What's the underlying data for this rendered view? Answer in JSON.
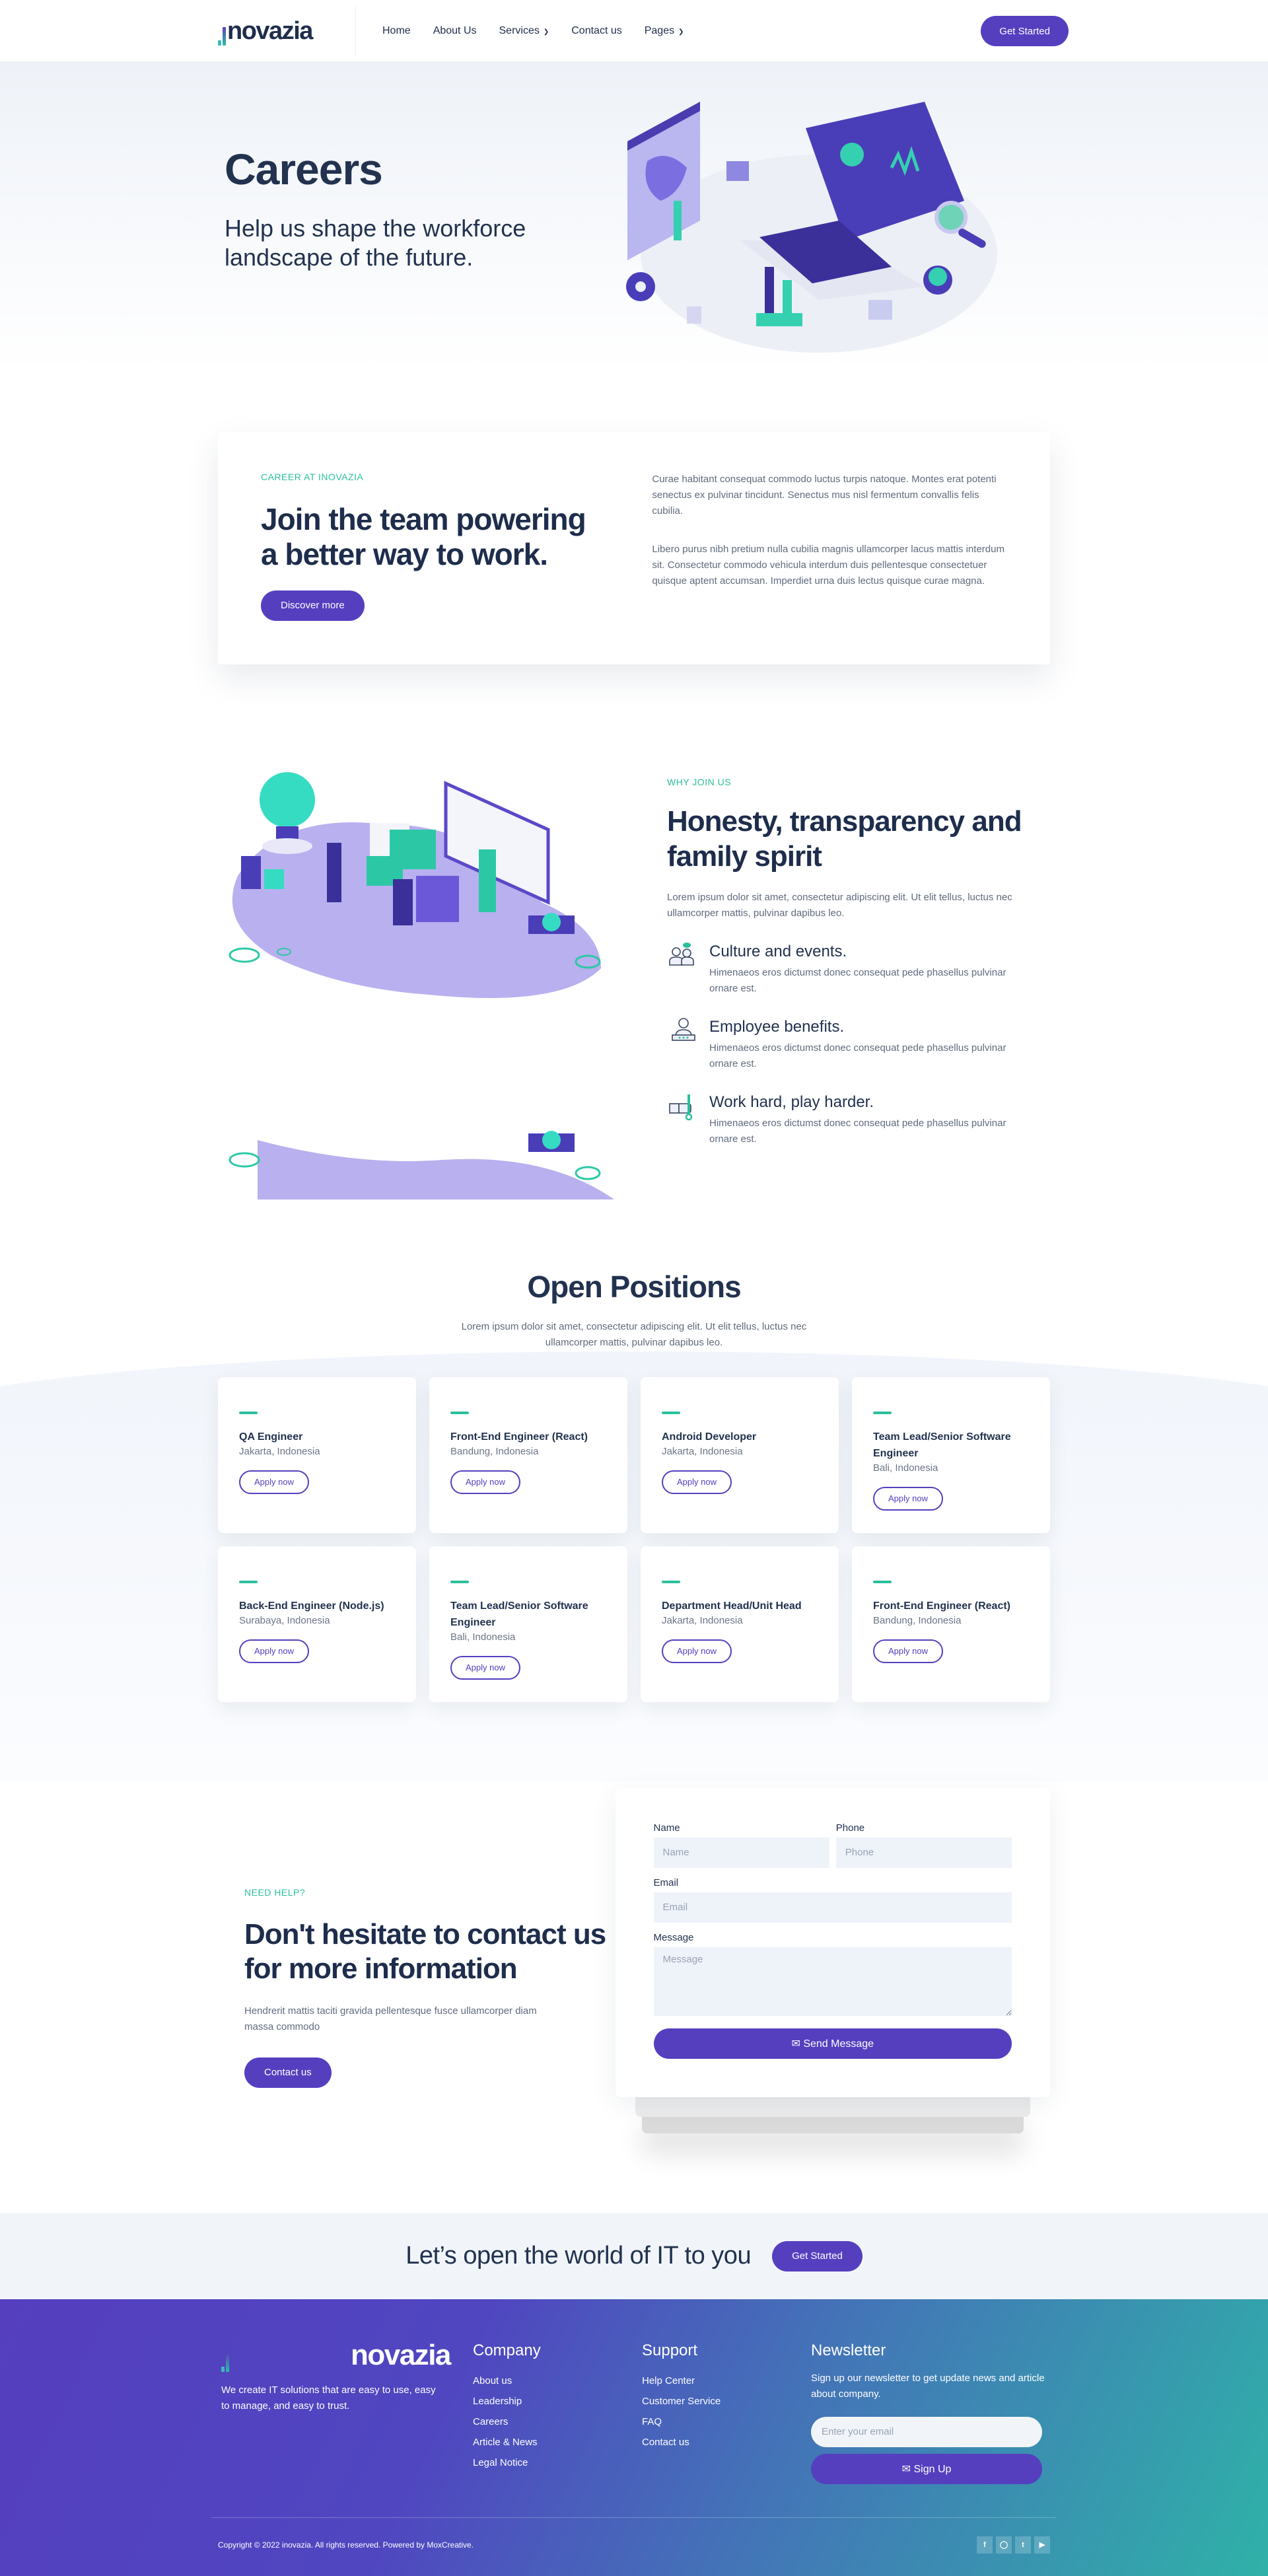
{
  "nav": {
    "brand": "novazia",
    "items": [
      {
        "label": "Home",
        "dropdown": false
      },
      {
        "label": "About Us",
        "dropdown": false
      },
      {
        "label": "Services",
        "dropdown": true
      },
      {
        "label": "Contact us",
        "dropdown": false
      },
      {
        "label": "Pages",
        "dropdown": true
      }
    ],
    "cta": "Get Started"
  },
  "hero": {
    "title": "Careers",
    "subtitle": "Help us shape the workforce landscape of the future."
  },
  "career": {
    "eyebrow": "CAREER AT INOVAZIA",
    "title": "Join the team powering a better way to work.",
    "button": "Discover more",
    "paragraphs": [
      "Curae habitant consequat commodo luctus turpis natoque. Montes erat potenti senectus ex pulvinar tincidunt. Senectus mus nisl fermentum convallis felis cubilia.",
      "Libero purus nibh pretium nulla cubilia magnis ullamcorper lacus mattis interdum sit. Consectetur commodo vehicula interdum duis pellentesque consectetuer quisque aptent accumsan. Imperdiet urna duis lectus quisque curae magna."
    ]
  },
  "why": {
    "eyebrow": "WHY JOIN US",
    "title": "Honesty, transparency and family spirit",
    "description": "Lorem ipsum dolor sit amet, consectetur adipiscing elit. Ut elit tellus, luctus nec ullamcorper mattis, pulvinar dapibus leo.",
    "features": [
      {
        "icon": "team-chat-icon",
        "title": "Culture and events.",
        "text": "Himenaeos eros dictumst donec consequat pede phasellus pulvinar ornare est."
      },
      {
        "icon": "employee-badge-icon",
        "title": "Employee benefits.",
        "text": "Himenaeos eros dictumst donec consequat pede phasellus pulvinar ornare est."
      },
      {
        "icon": "hand-wrench-icon",
        "title": "Work hard, play harder.",
        "text": "Himenaeos eros dictumst donec consequat pede phasellus pulvinar ornare est."
      }
    ]
  },
  "positions": {
    "title": "Open Positions",
    "description": "Lorem ipsum dolor sit amet, consectetur adipiscing elit. Ut elit tellus, luctus nec ullamcorper mattis, pulvinar dapibus leo.",
    "apply_label": "Apply now",
    "jobs": [
      {
        "title": "QA Engineer",
        "location": "Jakarta, Indonesia"
      },
      {
        "title": "Front-End Engineer (React)",
        "location": "Bandung, Indonesia"
      },
      {
        "title": "Android Developer",
        "location": "Jakarta, Indonesia"
      },
      {
        "title": "Team Lead/Senior Software Engineer",
        "location": "Bali, Indonesia"
      },
      {
        "title": "Back-End Engineer (Node.js)",
        "location": "Surabaya, Indonesia"
      },
      {
        "title": "Team Lead/Senior Software Engineer",
        "location": "Bali, Indonesia"
      },
      {
        "title": "Department Head/Unit Head",
        "location": "Jakarta, Indonesia"
      },
      {
        "title": "Front-End Engineer (React)",
        "location": "Bandung, Indonesia"
      }
    ]
  },
  "contact": {
    "eyebrow": "NEED HELP?",
    "title": "Don't hesitate to contact us for more information",
    "description": "Hendrerit mattis taciti gravida pellentesque fusce ullamcorper diam massa commodo",
    "button": "Contact us",
    "form": {
      "name_label": "Name",
      "name_placeholder": "Name",
      "name_value": "",
      "phone_label": "Phone",
      "phone_placeholder": "Phone",
      "phone_value": "",
      "email_label": "Email",
      "email_placeholder": "Email",
      "email_value": "",
      "message_label": "Message",
      "message_placeholder": "Message",
      "message_value": "",
      "submit": "Send Message"
    }
  },
  "cta_strip": {
    "title": "Let’s open the world of IT to you",
    "button": "Get Started"
  },
  "footer": {
    "brand": "novazia",
    "tagline": "We create IT solutions that are easy to use, easy to manage, and easy to trust.",
    "company": {
      "title": "Company",
      "links": [
        "About us",
        "Leadership",
        "Careers",
        "Article & News",
        "Legal Notice"
      ]
    },
    "support": {
      "title": "Support",
      "links": [
        "Help Center",
        "Customer Service",
        "FAQ",
        "Contact us"
      ]
    },
    "newsletter": {
      "title": "Newsletter",
      "text": "Sign up our newsletter to get update news and article about company.",
      "placeholder": "Enter your email",
      "button": "Sign Up"
    },
    "copyright": "Copyright © 2022 inovazia. All rights reserved. Powered by MoxCreative.",
    "socials": [
      "facebook",
      "instagram",
      "twitter",
      "youtube"
    ]
  },
  "colors": {
    "primary": "#553fbf",
    "accent": "#2bbf9c",
    "heading": "#22324f",
    "body_text": "#606b7d",
    "light_bg": "#f1f5fa"
  }
}
